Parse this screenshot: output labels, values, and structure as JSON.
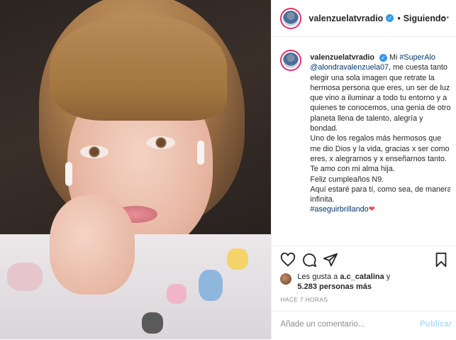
{
  "post": {
    "username": "valenzuelatvradio",
    "follow_separator": "•",
    "follow_label": "Siguiendo",
    "more_label": "···"
  },
  "caption": {
    "username": "valenzuelatvradio",
    "hashtag_superalo": "#SuperAlo",
    "mention": "@alondravalenzuela07",
    "para1": ", me cuesta tanto elegir una sola imagen que retrate la hermosa persona que eres, un ser de luz, que vino a iluminar a todo tu entorno y a quienes te conocemos, una genia de otro planeta llena de talento, alegría y bondad.",
    "para2": "Uno de los regalos más hermosos que me dio Dios y la vida, gracias x ser como eres, x alegrarnos y x enseñarnos tanto.",
    "para3": "Te amo con mi alma hija.",
    "para4": "Feliz cumpleaños N9.",
    "para5": "Aquí estaré para tí, como sea, de manera infinita.",
    "hashtag_end": "#aseguirbrillando",
    "heart": "❤",
    "mi": "Mi"
  },
  "likes": {
    "prefix": "Les gusta a",
    "user": "a.c_catalina",
    "conj": "y",
    "count": "5.283 personas más"
  },
  "timestamp": "HACE 7 HORAS",
  "comment": {
    "placeholder": "Añade un comentario...",
    "publish_label": "Publicar"
  },
  "icons": {
    "like": "heart-icon",
    "comment": "comment-icon",
    "share": "share-icon",
    "save": "bookmark-icon",
    "verified": "verified-badge-icon"
  },
  "colors": {
    "link": "#00376b",
    "verified": "#3897f0",
    "publish_disabled": "#b2dffc",
    "story_ring": "#e1306c"
  }
}
